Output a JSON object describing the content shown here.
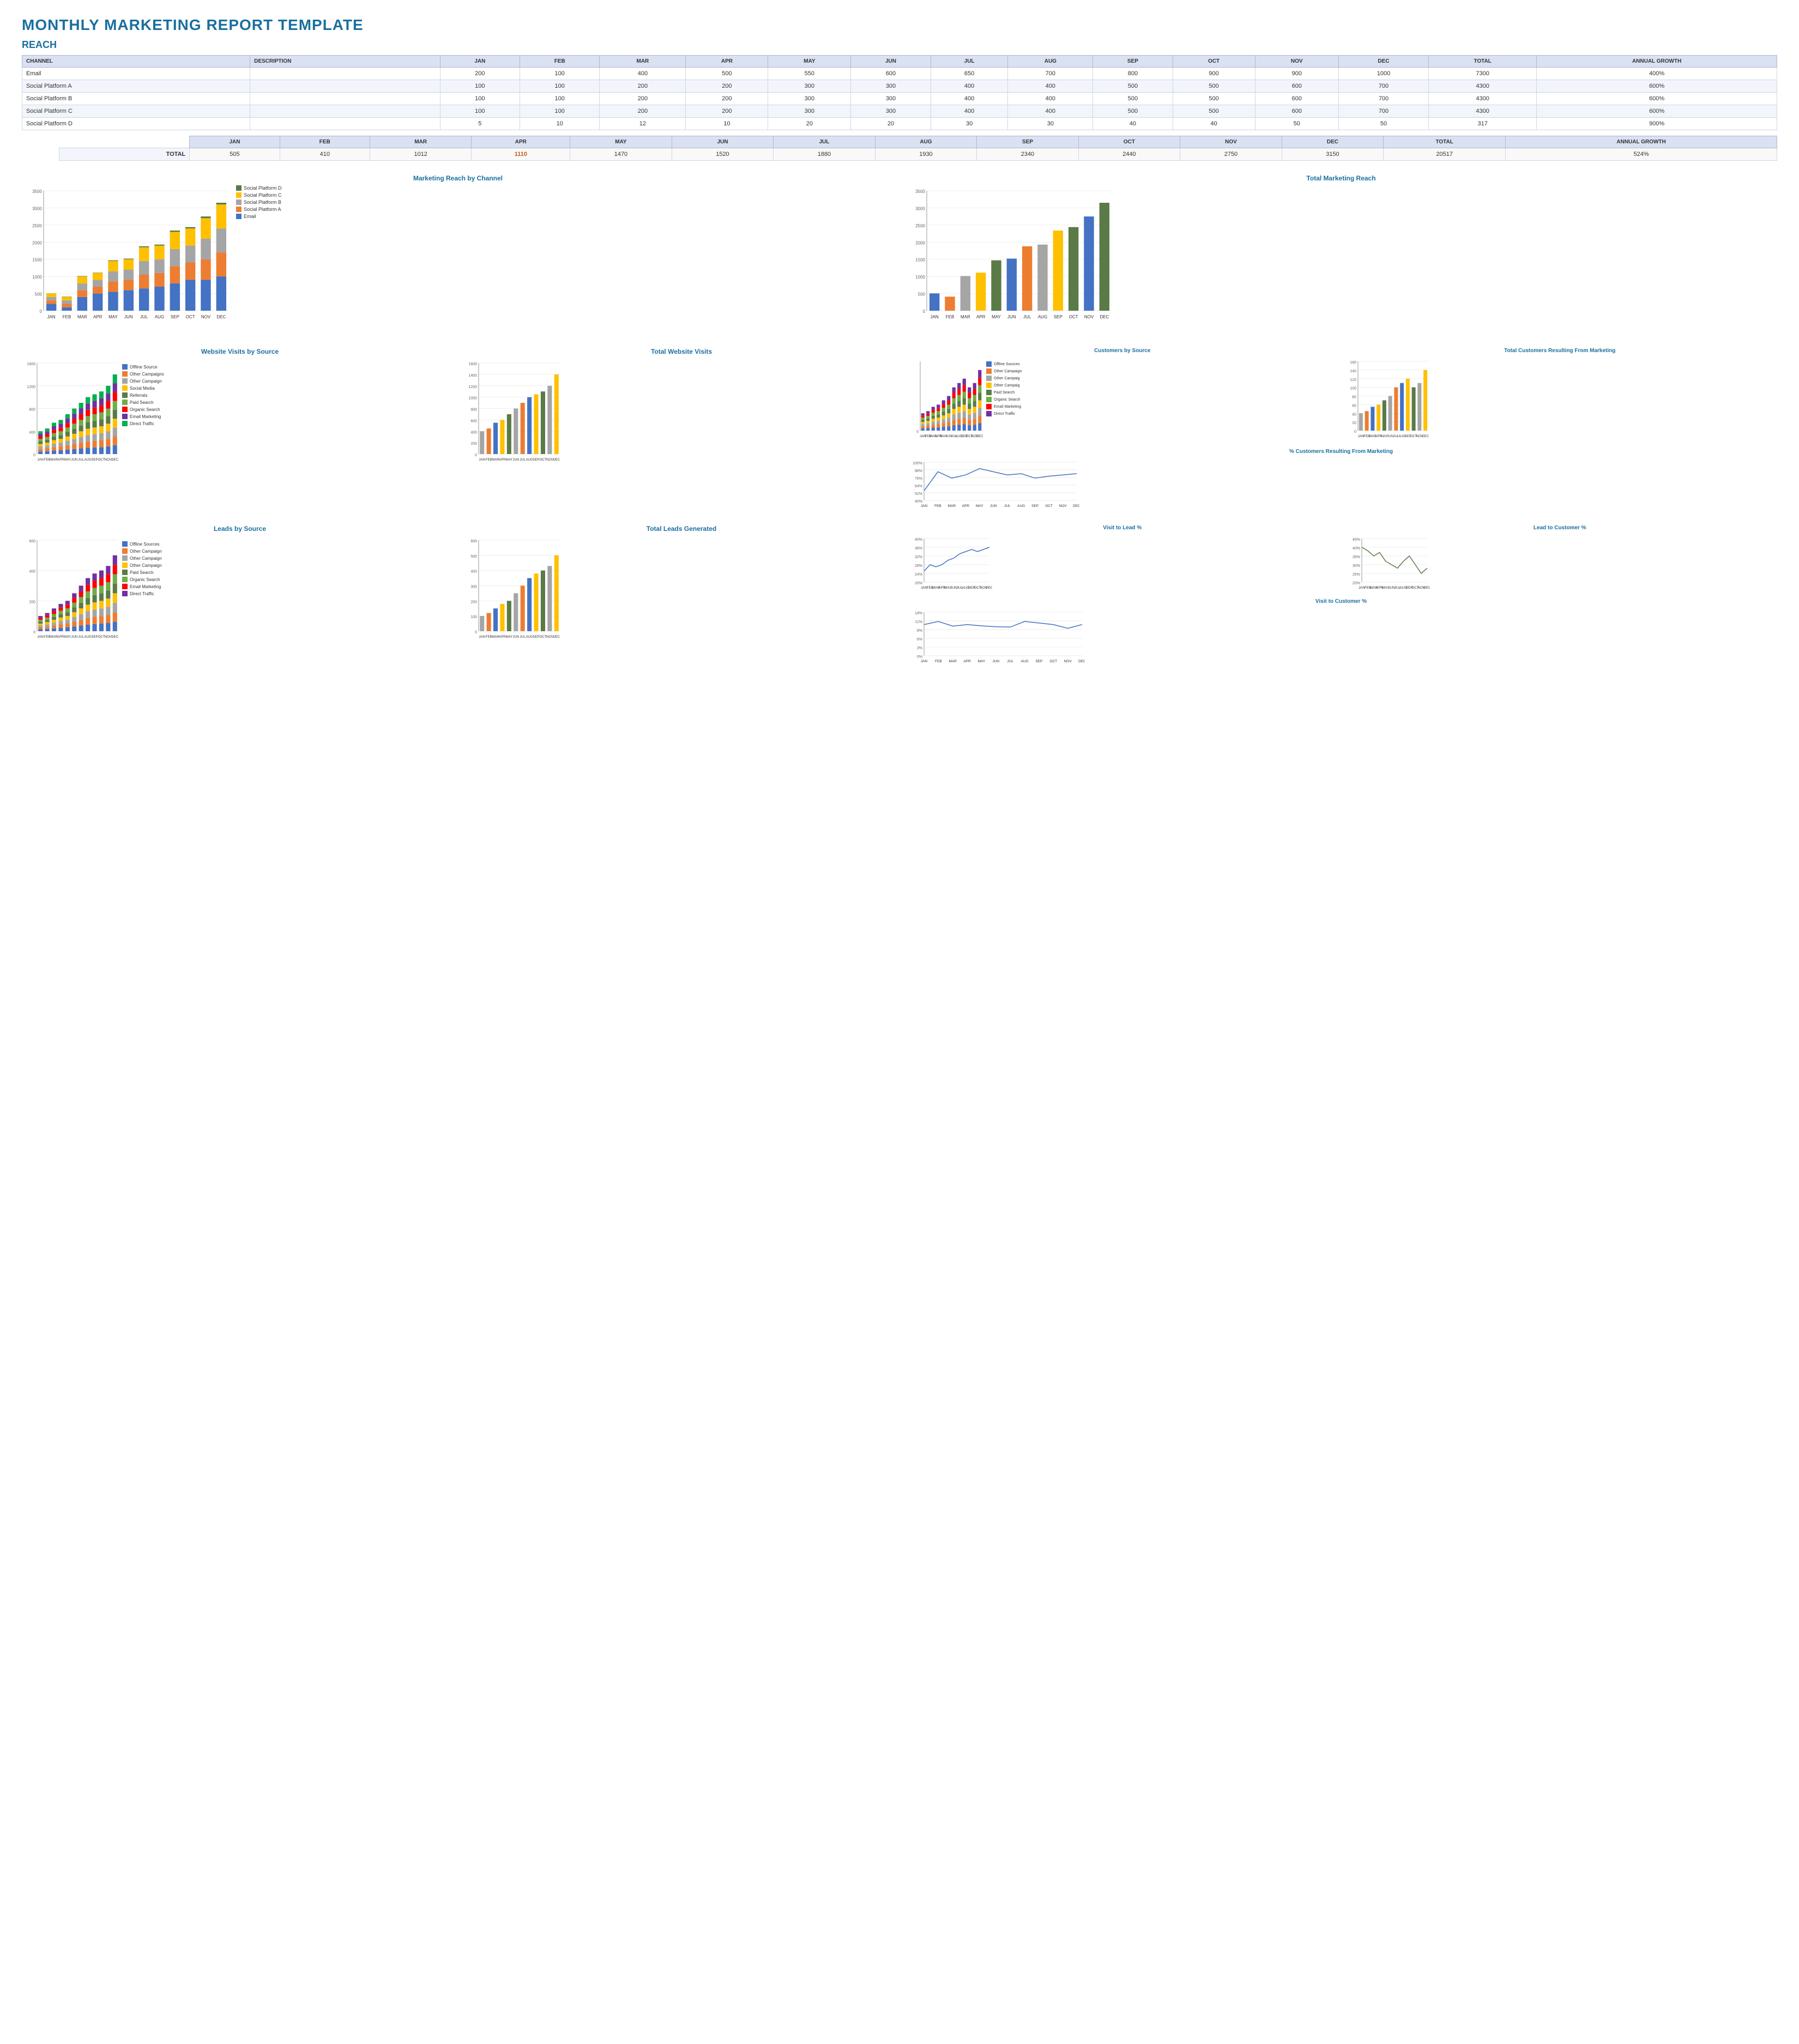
{
  "page": {
    "title": "MONTHLY MARKETING REPORT TEMPLATE",
    "reach_section": "REACH"
  },
  "reach_table": {
    "headers": [
      "CHANNEL",
      "DESCRIPTION",
      "JAN",
      "FEB",
      "MAR",
      "APR",
      "MAY",
      "JUN",
      "JUL",
      "AUG",
      "SEP",
      "OCT",
      "NOV",
      "DEC",
      "TOTAL",
      "ANNUAL GROWTH"
    ],
    "rows": [
      {
        "channel": "Email",
        "description": "",
        "jan": 200,
        "feb": 100,
        "mar": 400,
        "apr": 500,
        "may": 550,
        "jun": 600,
        "jul": 650,
        "aug": 700,
        "sep": 800,
        "oct": 900,
        "nov": 900,
        "dec": 1000,
        "total": 7300,
        "growth": "400%"
      },
      {
        "channel": "Social Platform A",
        "description": "",
        "jan": 100,
        "feb": 100,
        "mar": 200,
        "apr": 200,
        "may": 300,
        "jun": 300,
        "jul": 400,
        "aug": 400,
        "sep": 500,
        "oct": 500,
        "nov": 600,
        "dec": 700,
        "total": 4300,
        "growth": "600%"
      },
      {
        "channel": "Social Platform B",
        "description": "",
        "jan": 100,
        "feb": 100,
        "mar": 200,
        "apr": 200,
        "may": 300,
        "jun": 300,
        "jul": 400,
        "aug": 400,
        "sep": 500,
        "oct": 500,
        "nov": 600,
        "dec": 700,
        "total": 4300,
        "growth": "600%"
      },
      {
        "channel": "Social Platform C",
        "description": "",
        "jan": 100,
        "feb": 100,
        "mar": 200,
        "apr": 200,
        "may": 300,
        "jun": 300,
        "jul": 400,
        "aug": 400,
        "sep": 500,
        "oct": 500,
        "nov": 600,
        "dec": 700,
        "total": 4300,
        "growth": "600%"
      },
      {
        "channel": "Social Platform D",
        "description": "",
        "jan": 5,
        "feb": 10,
        "mar": 12,
        "apr": 10,
        "may": 20,
        "jun": 20,
        "jul": 30,
        "aug": 30,
        "sep": 40,
        "oct": 40,
        "nov": 50,
        "dec": 50,
        "total": 317,
        "growth": "900%"
      }
    ],
    "total_row": {
      "label": "TOTAL",
      "jan": 505,
      "feb": 410,
      "mar": 1012,
      "apr": 1110,
      "may": 1470,
      "jun": 1520,
      "jul": 1880,
      "aug": 1930,
      "sep": 2340,
      "oct": 2440,
      "nov": 2750,
      "dec": 3150,
      "total": 20517,
      "growth": "524%"
    }
  },
  "colors": {
    "email": "#4472c4",
    "spA": "#ed7d31",
    "spB": "#a5a5a5",
    "spC": "#ffc000",
    "spD": "#5a7a47",
    "accent": "#1a6fa0",
    "header_bg": "#d9e1f2"
  },
  "charts": {
    "reach_by_channel": {
      "title": "Marketing Reach by Channel",
      "months": [
        "JAN",
        "FEB",
        "MAR",
        "APR",
        "MAY",
        "JUN",
        "JUL",
        "AUG",
        "SEP",
        "OCT",
        "NOV",
        "DEC"
      ],
      "legend": [
        "Social Platform D",
        "Social Platform C",
        "Social Platform B",
        "Social Platform A",
        "Email"
      ],
      "data": {
        "email": [
          200,
          100,
          400,
          500,
          550,
          600,
          650,
          700,
          800,
          900,
          900,
          1000
        ],
        "spA": [
          100,
          100,
          200,
          200,
          300,
          300,
          400,
          400,
          500,
          500,
          600,
          700
        ],
        "spB": [
          100,
          100,
          200,
          200,
          300,
          300,
          400,
          400,
          500,
          500,
          600,
          700
        ],
        "spC": [
          100,
          100,
          200,
          200,
          300,
          300,
          400,
          400,
          500,
          500,
          600,
          700
        ],
        "spD": [
          5,
          10,
          12,
          10,
          20,
          20,
          30,
          30,
          40,
          40,
          50,
          50
        ]
      }
    },
    "total_reach": {
      "title": "Total Marketing Reach",
      "months": [
        "JAN",
        "FEB",
        "MAR",
        "APR",
        "MAY",
        "JUN",
        "JUL",
        "AUG",
        "SEP",
        "OCT",
        "NOV",
        "DEC"
      ],
      "totals": [
        505,
        410,
        1012,
        1110,
        1470,
        1520,
        1880,
        1930,
        2340,
        2440,
        2750,
        3150
      ],
      "colors": [
        "#4472c4",
        "#ed7d31",
        "#a5a5a5",
        "#ffc000",
        "#5a7a47",
        "#4472c4",
        "#ed7d31",
        "#a5a5a5",
        "#ffc000",
        "#5a7a47",
        "#4472c4",
        "#5a7a47"
      ]
    }
  },
  "website_visits": {
    "by_source_title": "Website Visits by Source",
    "total_title": "Total Website Visits",
    "months": [
      "JAN",
      "FEB",
      "MAR",
      "APR",
      "MAY",
      "JUN",
      "JUL",
      "AUG",
      "SEP",
      "OCT",
      "NOV",
      "DEC"
    ],
    "legend": [
      "Offline Source",
      "Other Campaigns",
      "Other Campaign",
      "Social Media",
      "Referrals",
      "Paid Search",
      "Organic Search",
      "Email Marketing",
      "Direct Traffic"
    ],
    "totals": [
      400,
      450,
      550,
      600,
      700,
      800,
      900,
      1000,
      1050,
      1100,
      1200,
      1400
    ],
    "colors_total": [
      "#a5a5a5",
      "#ed7d31",
      "#4472c4",
      "#ffc000",
      "#5a7a47",
      "#a5a5a5",
      "#ed7d31",
      "#4472c4",
      "#ffc000",
      "#5a7a47",
      "#a5a5a5",
      "#ffc000"
    ]
  },
  "customers": {
    "by_source_title": "Customers by Source",
    "total_title": "Total Customers Resulting From Marketing",
    "pct_title": "% Customers Resulting From Marketing",
    "months": [
      "JAN",
      "FEB",
      "MAR",
      "APR",
      "MAY",
      "JUN",
      "JUL",
      "AUG",
      "SEP",
      "OCT",
      "NOV",
      "DEC"
    ],
    "legend": [
      "Offline Sources",
      "Other Campaign",
      "Other Campaig",
      "Other Campaig",
      "Paid Search",
      "Organic Search",
      "Email Marketing",
      "Direct Traffic"
    ],
    "totals": [
      40,
      45,
      55,
      60,
      70,
      80,
      100,
      110,
      120,
      100,
      110,
      140
    ],
    "pct_values": [
      0.55,
      0.85,
      0.75,
      0.8,
      0.9,
      0.85,
      0.8,
      0.82,
      0.75,
      0.78,
      0.8,
      0.82
    ]
  },
  "leads": {
    "by_source_title": "Leads by Source",
    "total_title": "Total Leads Generated",
    "months": [
      "JAN",
      "FEB",
      "MAR",
      "APR",
      "MAY",
      "JUN",
      "JUL",
      "AUG",
      "SEP",
      "OCT",
      "NOV",
      "DEC"
    ],
    "legend": [
      "Offline Sources",
      "Other Campaign",
      "Other Campaign",
      "Other Campaign",
      "Paid Search",
      "Organic Search",
      "Email Marketing",
      "Direct Traffic"
    ],
    "totals": [
      100,
      120,
      150,
      180,
      200,
      250,
      300,
      350,
      380,
      400,
      430,
      500
    ],
    "colors_total": [
      "#a5a5a5",
      "#ed7d31",
      "#4472c4",
      "#ffc000",
      "#5a7a47",
      "#a5a5a5",
      "#ed7d31",
      "#4472c4",
      "#ffc000",
      "#5a7a47",
      "#a5a5a5",
      "#ffc000"
    ]
  },
  "conversion": {
    "visit_lead_title": "Visit to Lead %",
    "lead_customer_title": "Lead to Customer %",
    "visit_customer_title": "Visit to Customer %",
    "months": [
      "JAN",
      "FEB",
      "MAR",
      "APR",
      "MAY",
      "JUN",
      "JUL",
      "AUG",
      "SEP",
      "OCT",
      "NOV",
      "DEC"
    ],
    "visit_lead_pct": [
      0.25,
      0.28,
      0.27,
      0.28,
      0.3,
      0.31,
      0.33,
      0.34,
      0.35,
      0.34,
      0.35,
      0.36
    ],
    "lead_customer_pct": [
      0.4,
      0.38,
      0.35,
      0.37,
      0.32,
      0.3,
      0.28,
      0.32,
      0.35,
      0.3,
      0.25,
      0.28
    ],
    "visit_customer_pct": [
      0.1,
      0.11,
      0.095,
      0.1,
      0.096,
      0.093,
      0.092,
      0.11,
      0.105,
      0.1,
      0.088,
      0.1
    ]
  }
}
